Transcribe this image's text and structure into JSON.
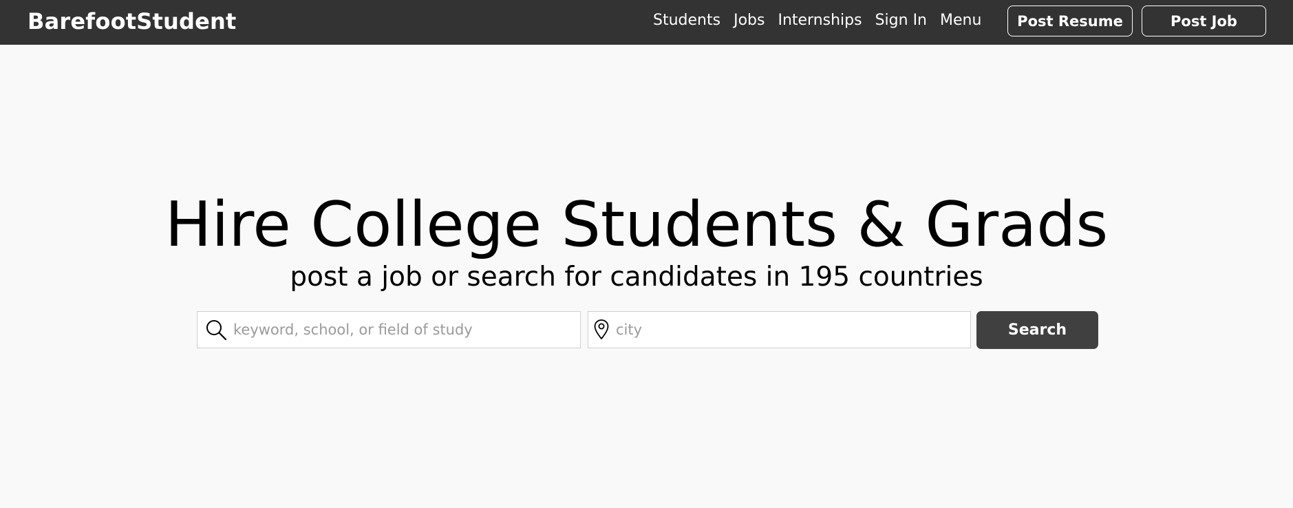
{
  "header": {
    "logo": "BarefootStudent",
    "nav": [
      {
        "label": "Students"
      },
      {
        "label": "Jobs"
      },
      {
        "label": "Internships"
      },
      {
        "label": "Sign In"
      },
      {
        "label": "Menu"
      }
    ],
    "post_resume_label": "Post Resume",
    "post_job_label": "Post Job",
    "background_color": "#333333"
  },
  "hero": {
    "title": "Hire College Students & Grads",
    "subtitle": "post a job or search for candidates in 195 countries"
  },
  "search": {
    "keyword_placeholder": "keyword, school, or field of study",
    "keyword_value": "",
    "keyword_icon": "search-icon",
    "city_placeholder": "city",
    "city_value": "",
    "city_icon": "map-pin-icon",
    "button_label": "Search",
    "button_color": "#404040"
  }
}
